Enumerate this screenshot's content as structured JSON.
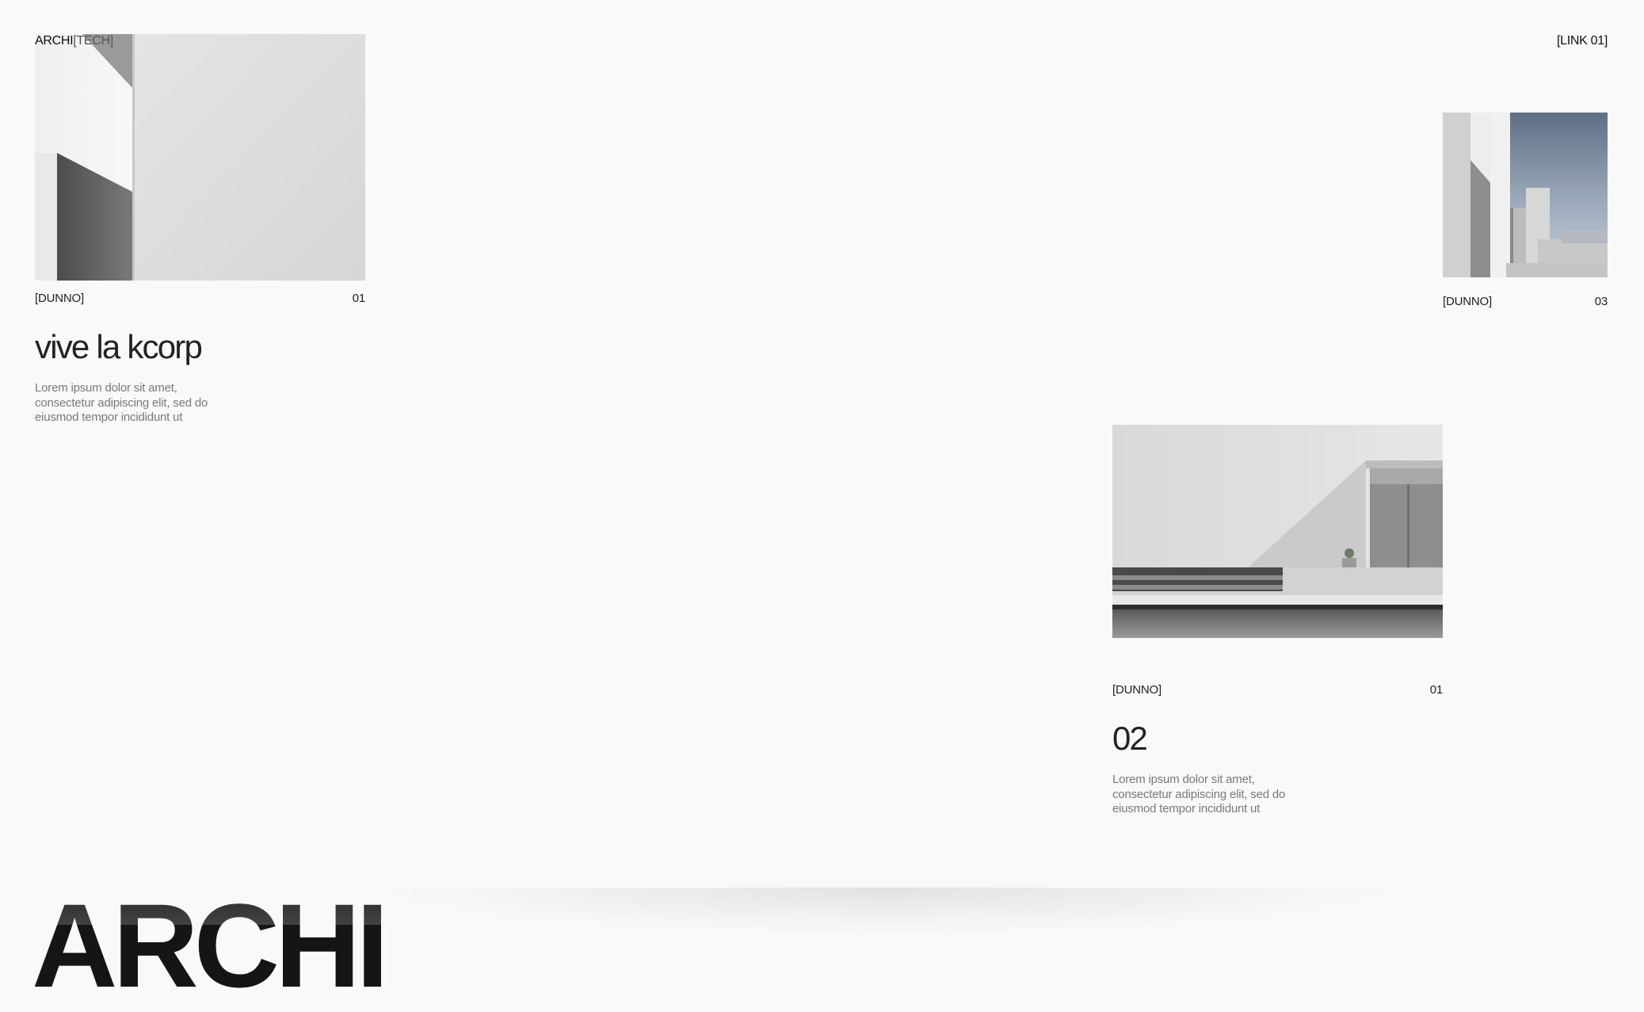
{
  "header": {
    "logo_main": "ARCHI",
    "logo_sub": "[TECH]",
    "nav_link": "[LINK 01]"
  },
  "projects": [
    {
      "tag": "[DUNNO]",
      "number": "01",
      "title": "vive la kcorp",
      "description": "Lorem ipsum dolor sit amet, consectetur adipiscing elit, sed do eiusmod tempor incididunt ut"
    },
    {
      "tag": "[DUNNO]",
      "number": "03"
    },
    {
      "tag": "[DUNNO]",
      "number": "01",
      "title": "02",
      "description": "Lorem ipsum dolor sit amet, consectetur adipiscing elit, sed do eiusmod tempor incididunt ut"
    }
  ],
  "footer": {
    "big_word": "ARCHI"
  },
  "colors": {
    "background": "#f9f9f9",
    "text": "#1a1a1a",
    "muted_text": "#7a7a7a"
  }
}
